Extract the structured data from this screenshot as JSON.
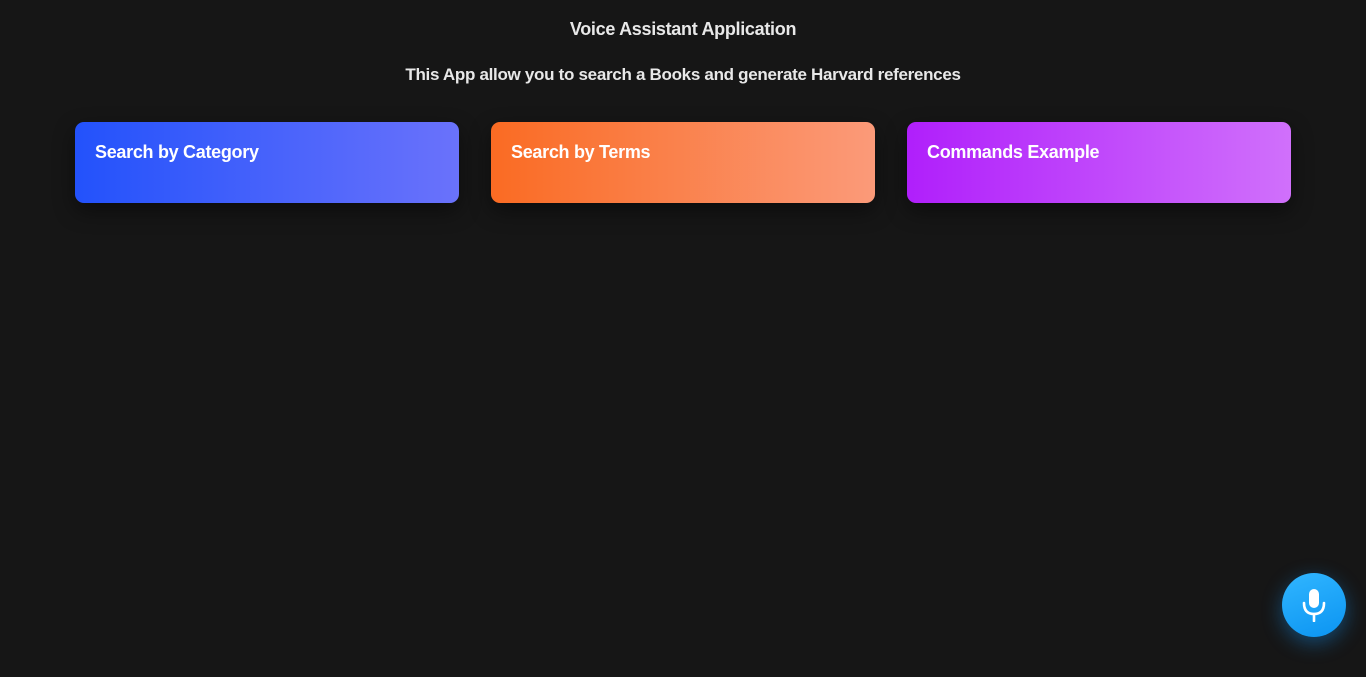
{
  "header": {
    "title": "Voice Assistant Application",
    "subtitle": "This App allow you to search a Books and generate Harvard references"
  },
  "cards": [
    {
      "label": "Search by Category",
      "color_start": "#2352fb",
      "color_end": "#6a72fb"
    },
    {
      "label": "Search by Terms",
      "color_start": "#fa6b23",
      "color_end": "#fb9a79"
    },
    {
      "label": "Commands Example",
      "color_start": "#b01ffb",
      "color_end": "#d070fb"
    }
  ],
  "mic_button": {
    "icon": "microphone-icon",
    "color": "#1ea8fb"
  },
  "theme": {
    "background": "#161616",
    "text": "#e8e8e8"
  }
}
